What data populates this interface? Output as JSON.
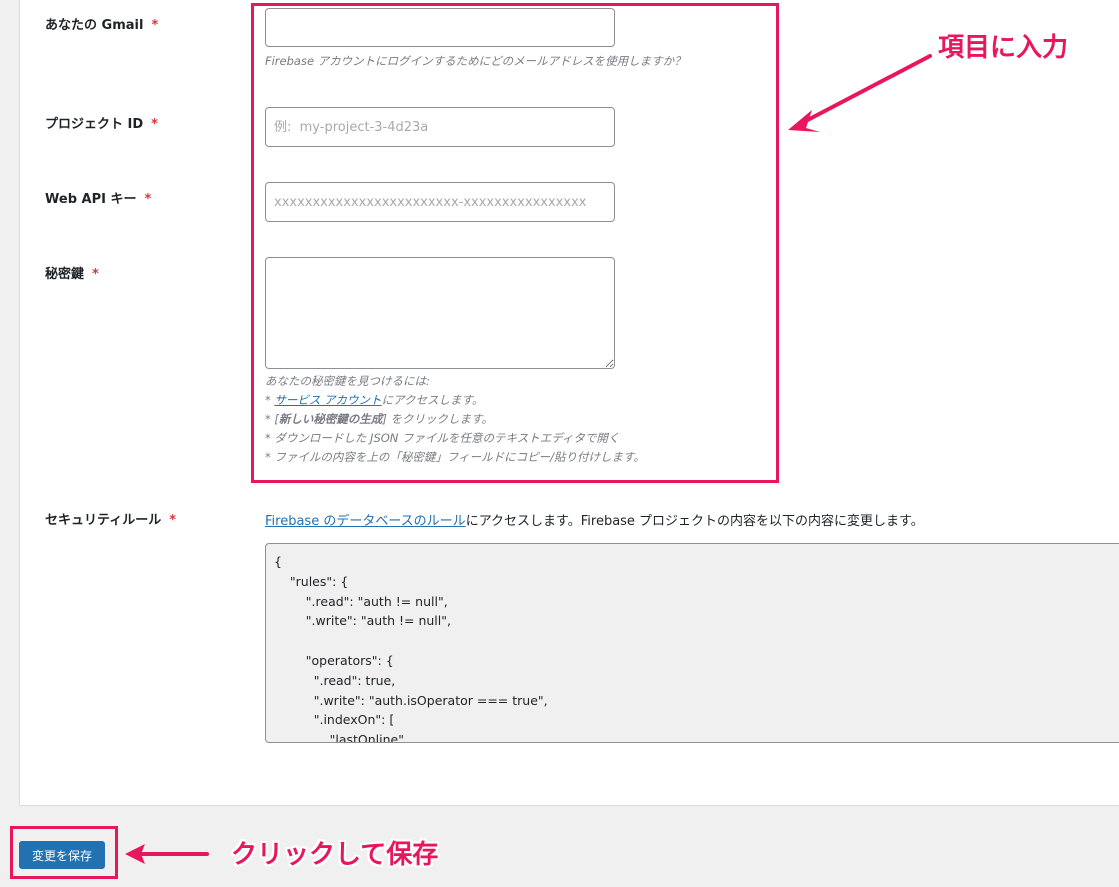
{
  "form": {
    "gmail": {
      "label": "あなたの Gmail",
      "required": "*",
      "value": "",
      "placeholder": "",
      "description": "Firebase アカウントにログインするためにどのメールアドレスを使用しますか？"
    },
    "project_id": {
      "label": "プロジェクト ID",
      "required": "*",
      "value": "",
      "placeholder": "例:  my-project-3-4d23a"
    },
    "api_key": {
      "label": "Web API キー",
      "required": "*",
      "value": "",
      "placeholder": "xxxxxxxxxxxxxxxxxxxxxxxx-xxxxxxxxxxxxxxxx"
    },
    "secret_key": {
      "label": "秘密鍵",
      "required": "*",
      "value": "",
      "help": {
        "intro": "あなたの秘密鍵を見つけるには:",
        "step1_prefix": "* ",
        "step1_link": "サービス アカウント",
        "step1_suffix": "にアクセスします。",
        "step2_prefix": "* [",
        "step2_bold": "新しい秘密鍵の生成",
        "step2_suffix": "] をクリックします。",
        "step3": "* ダウンロードした JSON ファイルを任意のテキストエディタで開く",
        "step4": "* ファイルの内容を上の「秘密鍵」フィールドにコピー/貼り付けします。"
      }
    },
    "security_rules": {
      "label": "セキュリティルール",
      "required": "*",
      "link": "Firebase のデータベースのルール",
      "text": "にアクセスします。Firebase プロジェクトの内容を以下の内容に変更します。",
      "code_lines": [
        "{",
        "    \"rules\": {",
        "        \".read\": \"auth != null\",",
        "        \".write\": \"auth != null\",",
        "",
        "        \"operators\": {",
        "          \".read\": true,",
        "          \".write\": \"auth.isOperator === true\",",
        "          \".indexOn\": [",
        "              \"lastOnline\""
      ]
    }
  },
  "save_button": {
    "label": "変更を保存"
  },
  "annotations": {
    "input_hint": "項目に入力",
    "save_hint": "クリックして保存",
    "accent_color": "#e8175d"
  }
}
